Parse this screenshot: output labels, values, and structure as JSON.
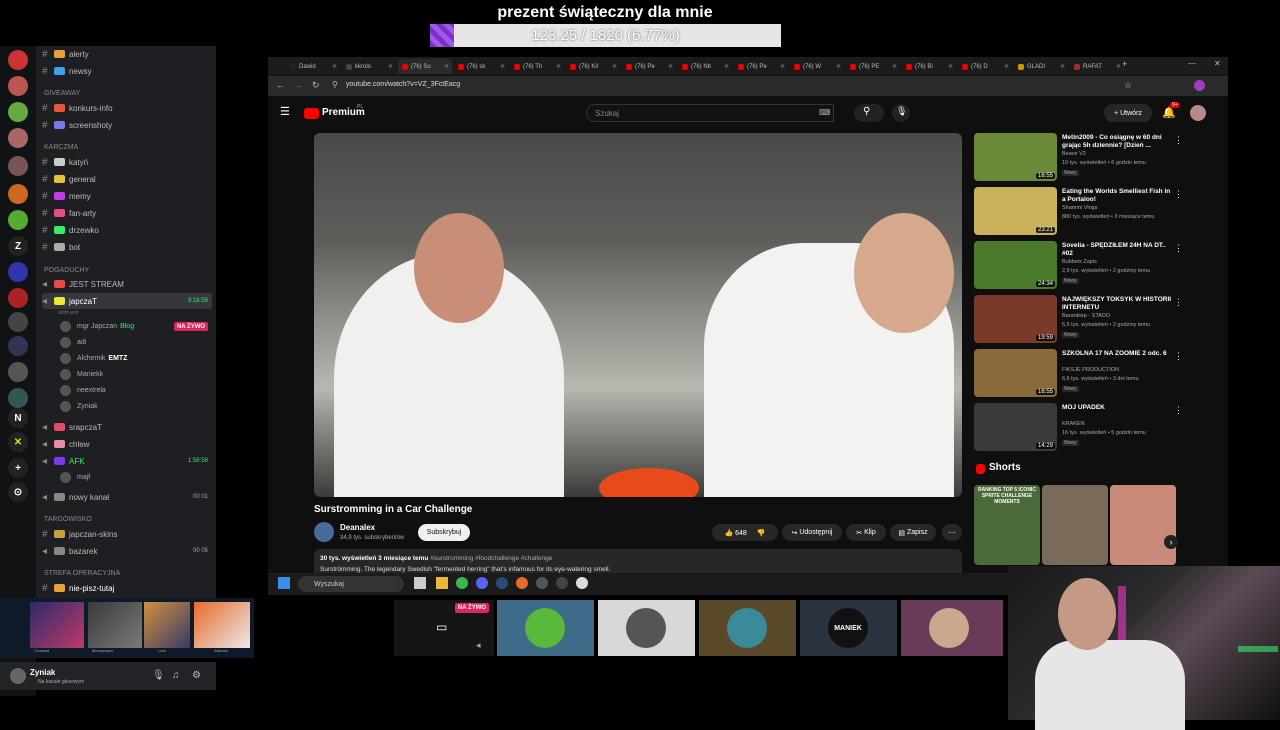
{
  "donation": {
    "title": "prezent świąteczny dla mnie",
    "progress_text": "123.25 / 1820 (6.77%)",
    "progress_fraction": 0.0677
  },
  "discord": {
    "channels": [
      {
        "label": "alerty",
        "color": "#e8a13a"
      },
      {
        "label": "newsy",
        "color": "#3aa0e8"
      },
      {
        "label": "konkurs-info",
        "color": "#e8563a"
      },
      {
        "label": "screenshoty",
        "color": "#7a7ae8"
      },
      {
        "label": "katyń",
        "color": "#cccccc"
      },
      {
        "label": "general",
        "color": "#e8c13a"
      },
      {
        "label": "memy",
        "color": "#c13ae8"
      },
      {
        "label": "fan-arty",
        "color": "#e84a8a"
      },
      {
        "label": "drzewko",
        "color": "#3ae86a"
      },
      {
        "label": "bot",
        "color": "#aaaaaa"
      }
    ],
    "categories": {
      "giveaway": "GIVEAWAY",
      "karczma": "KARCZMA",
      "pogaduchy": "POGADUCHY",
      "targowisko": "TARGOWISKO",
      "strefa": "STREFA OPERACYJNA"
    },
    "voice": {
      "jest_stream": "JEST STREAM",
      "japczat": "japczaT",
      "japczat_time": "9:18:59",
      "japczat_sub": "strim jest",
      "users": [
        "mgr Japczan",
        "adi",
        "Alchemik",
        "Maniekk",
        "neextrela",
        "Zyniak"
      ],
      "live_badge": "NA ŻYWO",
      "user_tag_1": "Błog",
      "user_tag_2": "EMTZ",
      "srapczat": "srapczaT",
      "chlew": "chlew",
      "afk": "AFK",
      "afk_time": "1:58:58",
      "afk_user": "majf",
      "nowy_kanal": "nowy kanał",
      "nowy_kanal_count": "00 01",
      "japczan_skins": "japczan-skins",
      "bazarek": "bazarek",
      "bazarek_count": "00 05",
      "nie_pisz": "nie-pisz-tutaj"
    },
    "weapon_labels": [
      "Crushed",
      "Monopopeo",
      "Lore",
      "Asiimov"
    ],
    "user_panel": {
      "name": "Zyniak",
      "status": "Na kanale głosowym"
    }
  },
  "browser": {
    "tabs": [
      "Dawid",
      "kkrolo",
      "(76) Su",
      "(76) sk",
      "(76) Th",
      "(76) Kil",
      "(76) Pe",
      "(76) Nb",
      "(76) Pe",
      "(76) W",
      "(76) PE",
      "(76) Bi",
      "(76) D",
      "GLADI",
      "RAFAT"
    ],
    "url": "youtube.com/watch?v=VZ_3FctEacg",
    "yt": {
      "logo": "Premium",
      "logo_sup": "PL",
      "search_placeholder": "Szukaj",
      "create": "Utwórz",
      "notif_count": "9+",
      "video_title": "Surstromming in a Car Challenge",
      "channel": "Deanalex",
      "subs": "34,9 tys. subskrybentów",
      "subscribe": "Subskrybuj",
      "likes": "648",
      "share": "Udostępnij",
      "clip": "Klip",
      "save": "Zapisz",
      "desc_meta": "30 tys. wyświetleń  3 miesiące temu",
      "desc_tags": "#surstromming #foodchallenge #challenge",
      "desc_text": "Surströmming. The legendary Swedish \"fermented herring\" that's infamous for its eye-watering smell.",
      "recommendations": [
        {
          "title": "Metin2009 - Co osiągnę w 60 dni grając 5h dziennie? [Dzień ...",
          "channel": "Beave V2",
          "views": "10 tys. wyświetleń • 6 godzin temu",
          "badge": "Nowy",
          "duration": "16:55",
          "color": "#6a8a3a"
        },
        {
          "title": "Eating the Worlds Smelliest Fish in a Portaloo!",
          "channel": "Shammi Vlogs",
          "views": "880 tys. wyświetleń • 3 miesiące temu",
          "badge": "",
          "duration": "23:21",
          "color": "#c9b25a"
        },
        {
          "title": "Sovelia - SPĘDZIŁEM 24H NA DT.. #02",
          "channel": "Bubbeix Zapis",
          "views": "2,9 tys. wyświetleń • 2 godziny temu",
          "badge": "Nowy",
          "duration": "24:34",
          "color": "#4a7a2a"
        },
        {
          "title": "NAJWIĘKSZY TOKSYK W HISTORII INTERNETU",
          "channel": "Barankiep - STADO",
          "views": "5,5 tys. wyświetleń • 2 godziny temu",
          "badge": "Nowy",
          "duration": "19:59",
          "color": "#7a3a2a"
        },
        {
          "title": "SZKOLNA 17 NA ZOOMIE 2 odc. 6",
          "channel": "FIKSJE PRODUCTION",
          "views": "6,6 tys. wyświetleń • 3 dni temu",
          "badge": "Nowy",
          "duration": "16:55",
          "color": "#8a6a3a"
        },
        {
          "title": "MÓJ UPADEK",
          "channel": "KRAKEN",
          "views": "16 tys. wyświetleń • 5 godzin temu",
          "badge": "Nowy",
          "duration": "14:29",
          "color": "#3a3a3a"
        }
      ],
      "shorts_title": "Shorts",
      "shorts": [
        {
          "label": "RANKING TOP 5 ICONIC SPRITE CHALLENGE MOMENTS",
          "color": "#4a6a3a"
        },
        {
          "label": "",
          "color": "#7a6a5a"
        },
        {
          "label": "",
          "color": "#c98a7a"
        }
      ]
    },
    "taskbar_search": "Wyszukaj"
  },
  "stream_tiles": [
    {
      "name": "live-tile",
      "color": "#151515",
      "label": ""
    },
    {
      "name": "frog-tile",
      "color": "#3d6b88",
      "label": ""
    },
    {
      "name": "car-tile",
      "color": "#d8d8d8",
      "label": ""
    },
    {
      "name": "person-tile",
      "color": "#5a4a2a",
      "label": ""
    },
    {
      "name": "maniek-tile",
      "color": "#2b3340",
      "label": "MANIEK"
    },
    {
      "name": "face-tile",
      "color": "#6a3a5a",
      "label": ""
    }
  ]
}
